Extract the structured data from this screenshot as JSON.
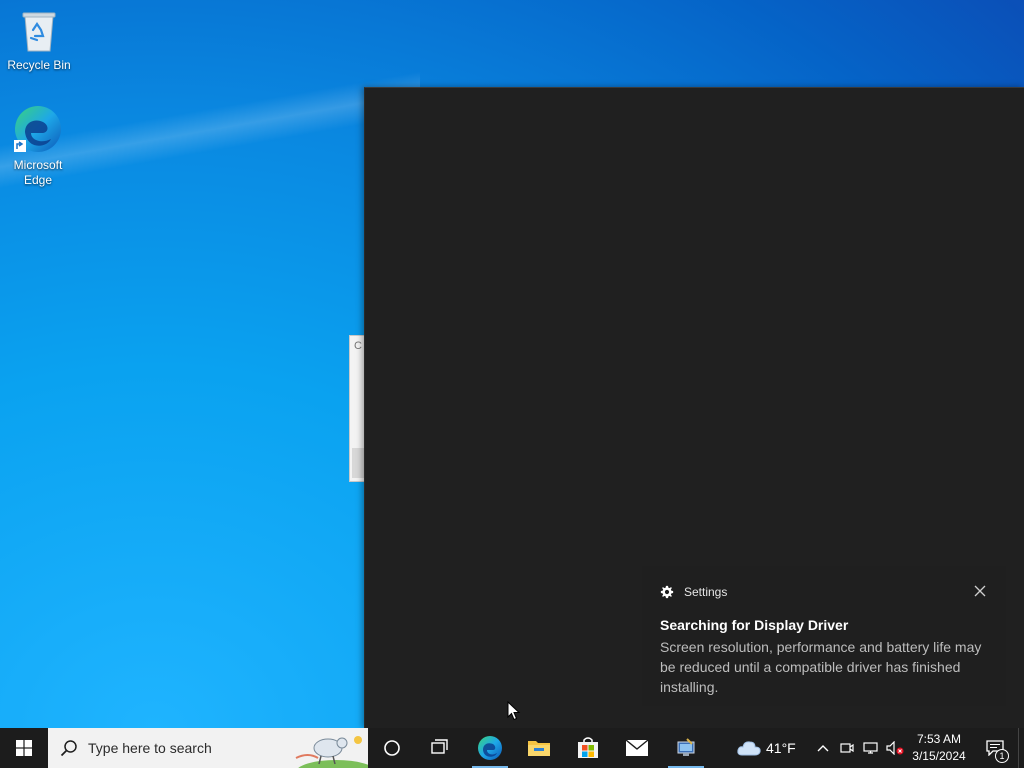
{
  "desktop": {
    "icons": [
      {
        "label": "Recycle Bin",
        "icon": "recycle-bin-icon"
      },
      {
        "label": "Microsoft Edge",
        "icon": "edge-icon"
      }
    ]
  },
  "background_window": {
    "visible_letter": "C"
  },
  "toast": {
    "app_name": "Settings",
    "app_icon": "gear-icon",
    "title": "Searching for Display Driver",
    "body": "Screen resolution, performance and battery life may be reduced until a compatible driver has finished installing.",
    "close_icon": "close-icon"
  },
  "taskbar": {
    "search_placeholder": "Type here to search",
    "pinned": [
      {
        "name": "Cortana",
        "icon": "circle-icon"
      },
      {
        "name": "Task View",
        "icon": "task-view-icon"
      },
      {
        "name": "Microsoft Edge",
        "icon": "edge-icon",
        "active": true
      },
      {
        "name": "File Explorer",
        "icon": "folder-icon"
      },
      {
        "name": "Microsoft Store",
        "icon": "store-icon"
      },
      {
        "name": "Mail",
        "icon": "mail-icon"
      },
      {
        "name": "Settings app",
        "icon": "settings-app-icon",
        "active": true
      }
    ],
    "weather": {
      "temp": "41°F",
      "icon": "cloud-icon"
    },
    "clock": {
      "time": "7:53 AM",
      "date": "3/15/2024"
    },
    "notification_count": "1"
  },
  "colors": {
    "desktop_blue": "#0a87e0",
    "dark_window": "#202020",
    "taskbar": "#1c1c1c",
    "accent": "#76b9ed"
  }
}
